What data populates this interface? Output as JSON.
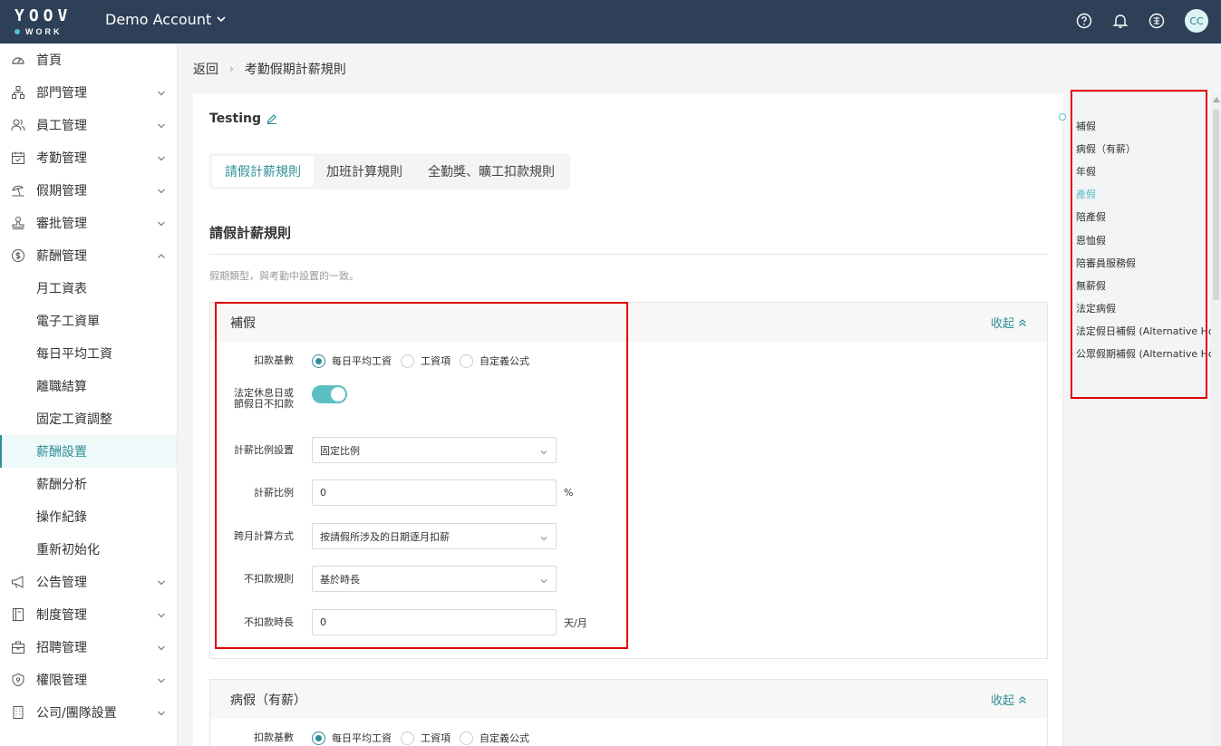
{
  "header": {
    "logo_top": "YOOV",
    "logo_bottom": "WORK",
    "account": "Demo Account",
    "avatar": "CC"
  },
  "sidebar": {
    "items": [
      {
        "label": "首頁",
        "icon": "dashboard-icon",
        "expandable": false
      },
      {
        "label": "部門管理",
        "icon": "org-chart-icon",
        "expandable": true
      },
      {
        "label": "員工管理",
        "icon": "users-icon",
        "expandable": true
      },
      {
        "label": "考勤管理",
        "icon": "calendar-check-icon",
        "expandable": true
      },
      {
        "label": "假期管理",
        "icon": "beach-icon",
        "expandable": true
      },
      {
        "label": "審批管理",
        "icon": "stamp-icon",
        "expandable": true
      },
      {
        "label": "薪酬管理",
        "icon": "dollar-icon",
        "expandable": true,
        "expanded": true
      }
    ],
    "payroll_sub": [
      "月工資表",
      "電子工資單",
      "每日平均工資",
      "離職結算",
      "固定工資調整",
      "薪酬設置",
      "薪酬分析",
      "操作紀錄",
      "重新初始化"
    ],
    "active_sub": "薪酬設置",
    "items_after": [
      {
        "label": "公告管理",
        "icon": "megaphone-icon"
      },
      {
        "label": "制度管理",
        "icon": "book-icon"
      },
      {
        "label": "招聘管理",
        "icon": "briefcase-icon"
      },
      {
        "label": "權限管理",
        "icon": "shield-icon"
      },
      {
        "label": "公司/團隊設置",
        "icon": "building-icon"
      }
    ]
  },
  "breadcrumb": {
    "back": "返回",
    "sep": "›",
    "current": "考勤假期計薪規則"
  },
  "card": {
    "policy_name": "Testing",
    "tabs": [
      "請假計薪規則",
      "加班計算規則",
      "全勤獎、曠工扣款規則"
    ],
    "active_tab": 0,
    "section_title": "請假計薪規則",
    "hint": "假期類型，與考勤中設置的一致。",
    "collapse_label": "收起"
  },
  "panels": [
    {
      "title": "補假",
      "labels": {
        "deduct_base": "扣款基數",
        "holiday_line1": "法定休息日或",
        "holiday_line2": "節假日不扣款",
        "ratio_setting": "計薪比例設置",
        "ratio": "計薪比例",
        "cross_month": "跨月計算方式",
        "no_deduct_rule": "不扣款規則",
        "no_deduct_duration": "不扣款時長"
      },
      "radio_options": [
        "每日平均工資",
        "工資項",
        "自定義公式"
      ],
      "radio_selected": 0,
      "holiday_toggle": true,
      "ratio_setting_value": "固定比例",
      "ratio_value": "0",
      "ratio_unit": "%",
      "cross_month_value": "按請假所涉及的日期逐月扣薪",
      "no_deduct_rule_value": "基於時長",
      "no_deduct_duration_value": "0",
      "duration_unit": "天/月"
    },
    {
      "title": "病假（有薪）",
      "labels": {
        "deduct_base": "扣款基數"
      },
      "radio_options": [
        "每日平均工資",
        "工資項",
        "自定義公式"
      ],
      "radio_selected": 0
    }
  ],
  "anchor_nav": {
    "items": [
      "補假",
      "病假（有薪）",
      "年假",
      "產假",
      "陪產假",
      "恩恤假",
      "陪審員服務假",
      "無薪假",
      "法定病假",
      "法定假日補假 (Alternative Holid...",
      "公眾假期補假 (Alternative Holid..."
    ],
    "active_index": 3
  },
  "colors": {
    "topbar": "#2e3f58",
    "accent": "#2e8f95",
    "toggle": "#5bbfc4",
    "annotation": "#e00000"
  }
}
